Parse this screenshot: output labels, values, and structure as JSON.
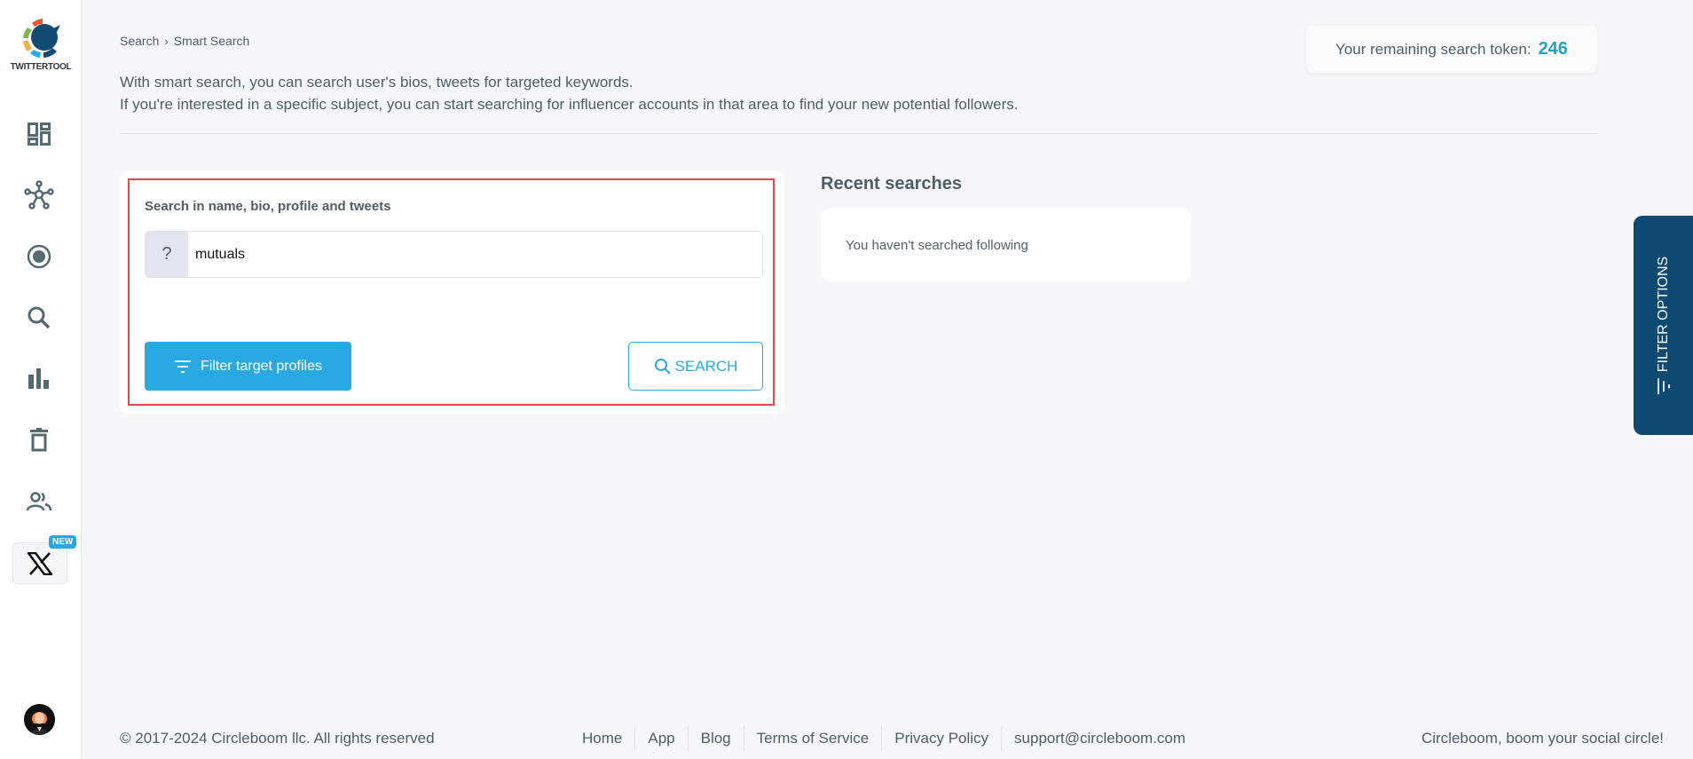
{
  "brand": {
    "name": "TWITTERTOOL"
  },
  "sidebar": {
    "items": [
      {
        "name": "dashboard",
        "icon": "dashboard-icon"
      },
      {
        "name": "network",
        "icon": "network-icon"
      },
      {
        "name": "circle",
        "icon": "radio-circle-icon"
      },
      {
        "name": "search",
        "icon": "search-icon"
      },
      {
        "name": "analytics",
        "icon": "bar-chart-icon"
      },
      {
        "name": "delete",
        "icon": "trash-icon"
      },
      {
        "name": "users",
        "icon": "people-icon"
      },
      {
        "name": "x",
        "icon": "x-logo-icon",
        "badge": "NEW"
      }
    ]
  },
  "breadcrumb": {
    "items": [
      "Search",
      "Smart Search"
    ],
    "separator": "›"
  },
  "intro": {
    "line1": "With smart search, you can search user's bios, tweets for targeted keywords.",
    "line2": "If you're interested in a specific subject, you can start searching for influencer accounts in that area to find your new potential followers."
  },
  "token": {
    "label": "Your remaining search token:",
    "value": "246",
    "color": "#1fa3c4"
  },
  "search": {
    "title": "Search in name, bio, profile and tweets",
    "prefix": "?",
    "value": "mutuals",
    "filter_button": "Filter target profiles",
    "search_button": "SEARCH"
  },
  "recent": {
    "title": "Recent searches",
    "empty_message": "You haven't searched following"
  },
  "filter_tab": {
    "label": "FILTER OPTIONS"
  },
  "footer": {
    "copyright": "© 2017-2024 Circleboom llc. All rights reserved",
    "links": [
      "Home",
      "App",
      "Blog",
      "Terms of Service",
      "Privacy Policy",
      "support@circleboom.com"
    ],
    "tagline": "Circleboom, boom your social circle!"
  }
}
